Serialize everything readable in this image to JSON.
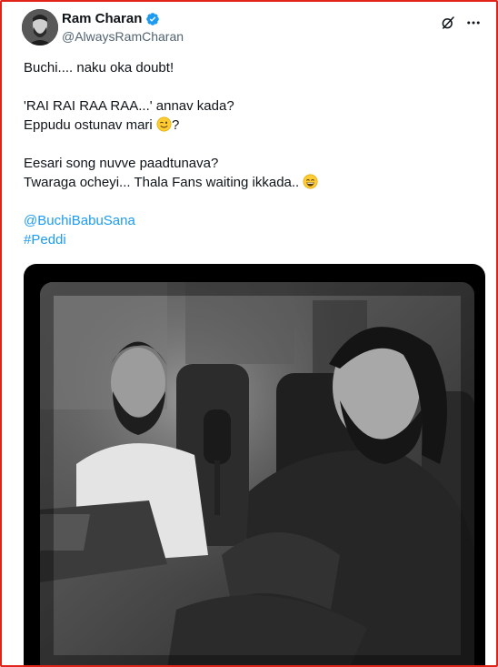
{
  "author": {
    "display_name": "Ram Charan",
    "handle": "@AlwaysRamCharan",
    "verified": true
  },
  "tweet": {
    "line1": "Buchi.... naku oka doubt!",
    "line2": "'RAI RAI RAA RAA...' annav kada?",
    "line3_text": "Eppudu ostunav mari",
    "line3_emoji": "winking-face",
    "line3_suffix": "?",
    "line4": "Eesari song nuvve paadtunava?",
    "line5_text": "Twaraga ocheyi... Thala Fans waiting ikkada..",
    "line5_emoji": "grinning-face-with-smiling-eyes",
    "mention": "@BuchiBabuSana",
    "hashtag": "#Peddi"
  },
  "media": {
    "type": "video-still",
    "description_colors": {
      "frame_bg": "#000000",
      "accent_link": "#1d9bf0"
    }
  },
  "icons": [
    "verified-badge-icon",
    "grok-icon",
    "more-options-icon"
  ]
}
